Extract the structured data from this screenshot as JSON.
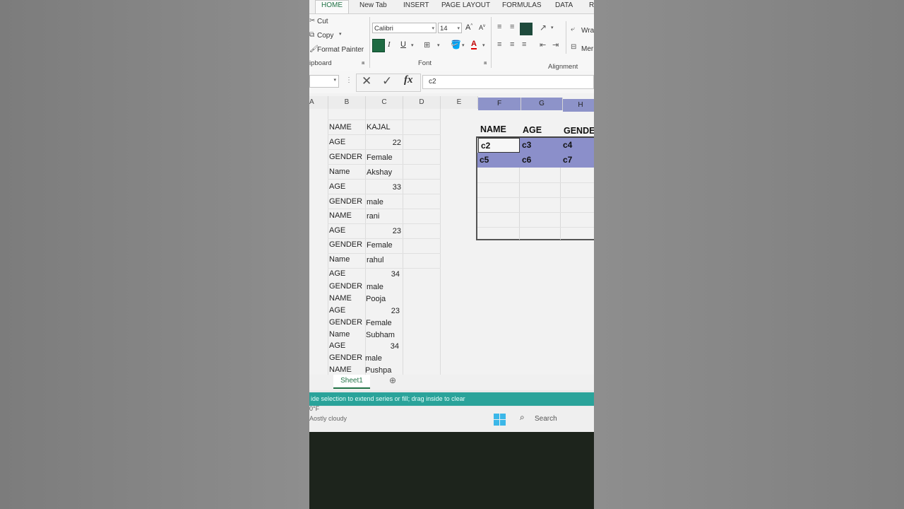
{
  "ribbon_tabs": [
    "HOME",
    "New Tab",
    "INSERT",
    "PAGE LAYOUT",
    "FORMULAS",
    "DATA",
    "RI"
  ],
  "clipboard": {
    "cut": "Cut",
    "copy": "Copy",
    "format_painter": "Format Painter",
    "label": "ipboard"
  },
  "font": {
    "family": "Calibri",
    "size": "14",
    "grow": "A",
    "shrink": "A",
    "bold": "B",
    "italic": "I",
    "underline": "U",
    "font_color_letter": "A",
    "label": "Font"
  },
  "alignment": {
    "wrap": "Wra",
    "merge": "Mer",
    "label": "Alignment"
  },
  "formula_bar": {
    "value": "c2",
    "fx": "fx"
  },
  "columns": [
    "A",
    "B",
    "C",
    "D",
    "E",
    "F",
    "G",
    "H"
  ],
  "rows": [
    {
      "b": "NAME",
      "c": "KAJAL"
    },
    {
      "b": "AGE",
      "c": "22"
    },
    {
      "b": "GENDER",
      "c": "Female"
    },
    {
      "b": "Name",
      "c": "Akshay"
    },
    {
      "b": "AGE",
      "c": "33"
    },
    {
      "b": "GENDER",
      "c": "male"
    },
    {
      "b": "NAME",
      "c": "rani"
    },
    {
      "b": "AGE",
      "c": "23"
    },
    {
      "b": "GENDER",
      "c": "Female"
    },
    {
      "b": "Name",
      "c": "rahul"
    },
    {
      "b": "AGE",
      "c": "34"
    },
    {
      "b": "GENDER",
      "c": "male"
    },
    {
      "b": "NAME",
      "c": "Pooja"
    },
    {
      "b": "AGE",
      "c": "23"
    },
    {
      "b": "GENDER",
      "c": "Female"
    },
    {
      "b": "Name",
      "c": "Subham"
    },
    {
      "b": "AGE",
      "c": "34"
    },
    {
      "b": "GENDER",
      "c": "male"
    },
    {
      "b": "NAME",
      "c": "Pushpa"
    }
  ],
  "summary_table": {
    "headers": [
      "NAME",
      "AGE",
      "GENDE"
    ],
    "rows": [
      [
        "c2",
        "c3",
        "c4"
      ],
      [
        "c5",
        "c6",
        "c7"
      ]
    ]
  },
  "sheet_tab": "Sheet1",
  "status_text": "ide selection to extend series or fill; drag inside to clear",
  "taskbar": {
    "temp": "0°F",
    "weather": "Aostly cloudy",
    "search": "Search"
  },
  "colors": {
    "accent_green": "#217346",
    "selection_blue": "#8b8fca",
    "status_teal": "#2aa39a"
  }
}
